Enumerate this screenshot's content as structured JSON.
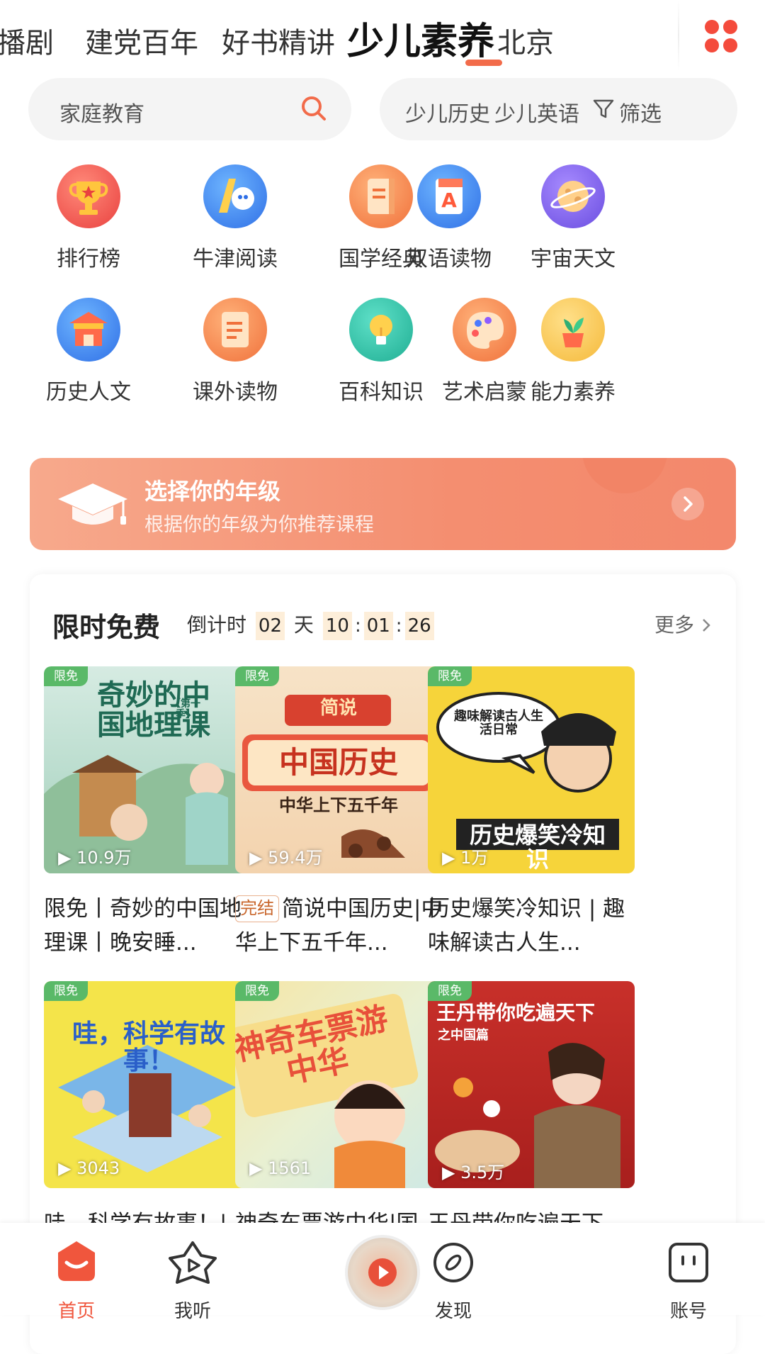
{
  "top_tabs": [
    {
      "label": "播剧",
      "active": false
    },
    {
      "label": "建党百年",
      "active": false
    },
    {
      "label": "好书精讲",
      "active": false
    },
    {
      "label": "少儿素养",
      "active": true
    },
    {
      "label": "北京",
      "active": false
    }
  ],
  "search": {
    "placeholder": "家庭教育"
  },
  "quick_filters": {
    "item1": "少儿历史",
    "item2": "少儿英语",
    "filter_label": "筛选"
  },
  "categories": [
    {
      "label": "排行榜",
      "icon": "trophy-icon"
    },
    {
      "label": "牛津阅读",
      "icon": "oxford-reading-icon"
    },
    {
      "label": "国学经典",
      "icon": "classic-book-icon"
    },
    {
      "label": "双语读物",
      "icon": "bilingual-book-icon"
    },
    {
      "label": "宇宙天文",
      "icon": "planet-icon"
    },
    {
      "label": "历史人文",
      "icon": "palace-icon"
    },
    {
      "label": "课外读物",
      "icon": "notebook-icon"
    },
    {
      "label": "百科知识",
      "icon": "lightbulb-icon"
    },
    {
      "label": "艺术启蒙",
      "icon": "palette-icon"
    },
    {
      "label": "能力素养",
      "icon": "plant-pot-icon"
    }
  ],
  "banner": {
    "title": "选择你的年级",
    "subtitle": "根据你的年级为你推荐课程"
  },
  "free_section": {
    "title": "限时免费",
    "countdown_label": "倒计时",
    "days": "02",
    "day_unit": "天",
    "hours": "10",
    "minutes": "01",
    "seconds": "26",
    "sep1": ":",
    "sep2": ":",
    "more": "更多"
  },
  "items": [
    {
      "tag": "限免",
      "plays": "10.9万",
      "cover": "奇妙的中国地理课",
      "cover_sub": "【第一季】",
      "title": "限免丨奇妙的中国地理课丨晚安睡..."
    },
    {
      "tag": "限免",
      "plays": "59.4万",
      "cover": "中国历史",
      "cover_top": "简说",
      "cover_sub": "中华上下五千年",
      "badge": "完结",
      "title": "简说中国历史|中华上下五千年..."
    },
    {
      "tag": "限免",
      "plays": "1万",
      "cover": "历史爆笑冷知识",
      "cover_sub": "趣味解读古人生活日常",
      "title": "历史爆笑冷知识 | 趣味解读古人生..."
    },
    {
      "tag": "限免",
      "plays": "3043",
      "cover": "哇，科学有故事！",
      "title": "哇，科学有故事！|"
    },
    {
      "tag": "限免",
      "plays": "1561",
      "cover": "神奇车票游中华",
      "title": "神奇车票游中华|国"
    },
    {
      "tag": "限免",
      "plays": "3.5万",
      "cover": "王丹带你吃遍天下",
      "cover_sub": "之中国篇",
      "title": "王丹带你吃遍天下"
    }
  ],
  "bottom_nav": [
    {
      "label": "首页",
      "icon": "home-icon",
      "active": true
    },
    {
      "label": "我听",
      "icon": "listen-star-icon",
      "active": false
    },
    {
      "label": "发现",
      "icon": "discover-icon",
      "active": false
    },
    {
      "label": "账号",
      "icon": "account-icon",
      "active": false
    }
  ],
  "colors": {
    "accent": "#f26b4a",
    "banner": "#f48e70",
    "tag_green": "#5ab968",
    "countdown_bg": "#fdeed9",
    "active_nav": "#f0563d"
  }
}
